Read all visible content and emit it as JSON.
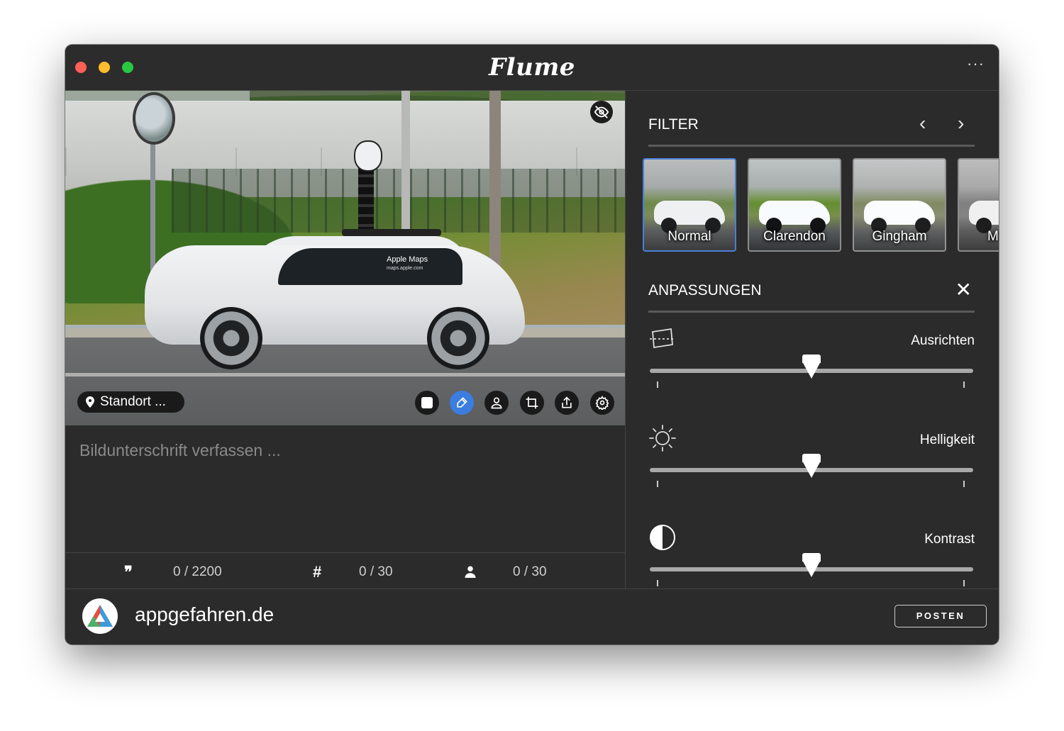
{
  "window": {
    "title": "Flume",
    "more_label": "···"
  },
  "photo": {
    "car_text_line1": "Apple Maps",
    "car_text_line2": "maps.apple.com",
    "location_label": "Standort ...",
    "toolbar": [
      "square-icon",
      "brush-icon",
      "person-icon",
      "crop-icon",
      "share-icon",
      "gear-icon"
    ],
    "active_tool": "brush-icon"
  },
  "caption": {
    "placeholder": "Bildunterschrift verfassen ...",
    "value": ""
  },
  "counters": {
    "characters": "0 / 2200",
    "hashtags": "0 / 30",
    "mentions": "0 / 30",
    "characters_icon": "❞",
    "hashtags_icon": "#"
  },
  "filters": {
    "title": "FILTER",
    "prev": "‹",
    "next": "›",
    "items": [
      "Normal",
      "Clarendon",
      "Gingham",
      "M"
    ],
    "selected": "Normal"
  },
  "adjustments": {
    "title": "ANPASSUNGEN",
    "close": "✕",
    "items": [
      {
        "label": "Ausrichten",
        "icon": "straighten-icon",
        "value": 0.5
      },
      {
        "label": "Helligkeit",
        "icon": "brightness-icon",
        "value": 0.5
      },
      {
        "label": "Kontrast",
        "icon": "contrast-icon",
        "value": 0.5
      }
    ]
  },
  "footer": {
    "account": "appgefahren.de",
    "post_label": "POSTEN"
  },
  "colors": {
    "accent": "#3b7de0",
    "background": "#2b2b2b",
    "selected_filter_border": "#4a7fd6"
  }
}
